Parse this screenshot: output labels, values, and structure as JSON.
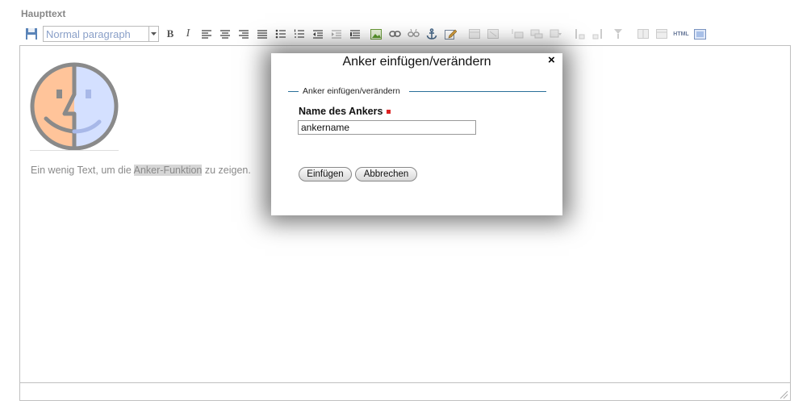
{
  "field_label": "Haupttext",
  "toolbar": {
    "format_select_value": "Normal paragraph",
    "bold_label": "B",
    "italic_label": "I",
    "html_label": "HTML"
  },
  "editor": {
    "text_before": "Ein wenig Text, um die ",
    "anchor_text": "Anker-Funktion",
    "text_after": " zu zeigen."
  },
  "dialog": {
    "title": "Anker einfügen/verändern",
    "close_glyph": "×",
    "legend": "Anker einfügen/verändern",
    "name_label": "Name des Ankers",
    "name_value": "ankername",
    "insert_button": "Einfügen",
    "cancel_button": "Abbrechen"
  },
  "colors": {
    "required_marker": "#dd2222",
    "fieldset_line": "#2a6f9a",
    "face_left": "#ffc49a",
    "face_right": "#d4e0ff"
  }
}
